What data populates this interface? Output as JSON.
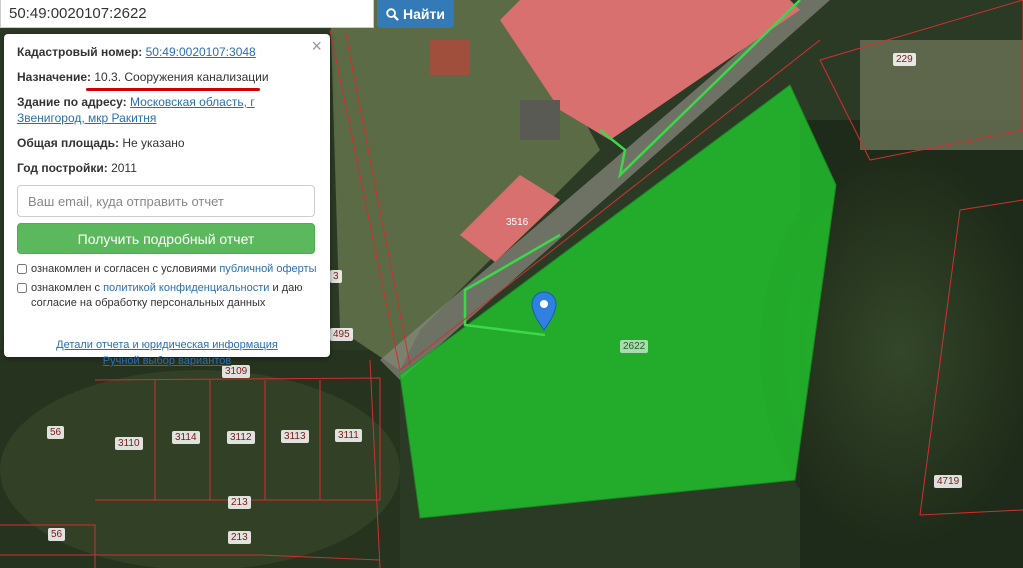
{
  "search": {
    "value": "50:49:0020107:2622",
    "button_label": "Найти"
  },
  "popup": {
    "cadastral_label": "Кадастровый номер:",
    "cadastral_value": "50:49:0020107:3048",
    "purpose_label": "Назначение:",
    "purpose_value": "10.3. Сооружения канализации",
    "building_label": "Здание по адресу:",
    "building_value": "Московская область, г Звенигород, мкр Ракитня",
    "area_label": "Общая площадь:",
    "area_value": "Не указано",
    "year_label": "Год постройки:",
    "year_value": "2011",
    "email_placeholder": "Ваш email, куда отправить отчет",
    "report_button": "Получить подробный отчет",
    "check1_text": "ознакомлен и согласен с условиями ",
    "check1_link": "публичной оферты",
    "check2_text1": "ознакомлен с ",
    "check2_link": "политикой конфиденциальности",
    "check2_text2": " и даю согласие на обработку персональных данных",
    "footer_link1": "Детали отчета и юридическая информация",
    "footer_link2": "Ручной выбор вариантов",
    "close": "×"
  },
  "parcels": [
    "229",
    "3516",
    "2622",
    "495",
    "3",
    "3109",
    "3110",
    "3114",
    "3112",
    "3113",
    "3111",
    "56",
    "56",
    "213",
    "213",
    "4719"
  ],
  "colors": {
    "highlight": "#22c42e",
    "border": "#d03030",
    "button_blue": "#337ab7",
    "button_green": "#5cb85c"
  }
}
